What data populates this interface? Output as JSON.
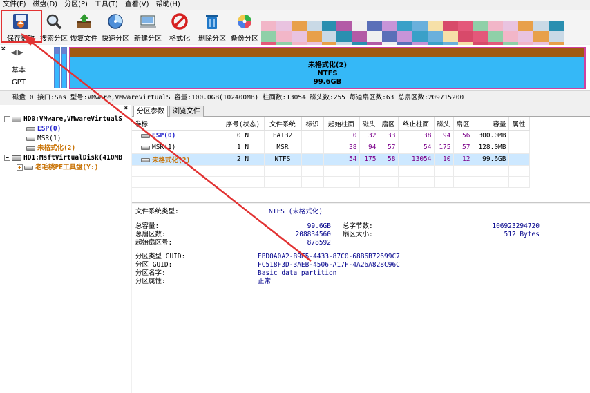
{
  "menu": [
    "文件(F)",
    "磁盘(D)",
    "分区(P)",
    "工具(T)",
    "查看(V)",
    "帮助(H)"
  ],
  "toolbar": {
    "save": "保存更改",
    "search": "搜索分区",
    "restore": "恢复文件",
    "quick": "快速分区",
    "new": "新建分区",
    "format": "格式化",
    "delete": "删除分区",
    "backup": "备份分区"
  },
  "disk_panel": {
    "kind": "基本",
    "scheme": "GPT",
    "partition_name": "未格式化(2)",
    "partition_fs": "NTFS",
    "partition_size": "99.6GB"
  },
  "disk_info": "磁盘 0 接口:Sas  型号:VMware,VMwareVirtualS  容量:100.0GB(102400MB)  柱面数:13054  磁头数:255  每道扇区数:63  总扇区数:209715200",
  "tree": {
    "disk0": "HD0:VMware,VMwareVirtualS",
    "disk0_parts": [
      "ESP(0)",
      "MSR(1)",
      "未格式化(2)"
    ],
    "disk1": "HD1:MsftVirtualDisk(410MB",
    "disk1_parts": [
      "老毛桃PE工具盘(Y:)"
    ]
  },
  "tabs": [
    "分区参数",
    "浏览文件"
  ],
  "table": {
    "headers": [
      "卷标",
      "序号(状态)",
      "文件系统",
      "标识",
      "起始柱面",
      "磁头",
      "扇区",
      "终止柱面",
      "磁头",
      "扇区",
      "容量",
      "属性"
    ],
    "rows": [
      {
        "label": "ESP(0)",
        "index": "0 N",
        "fs": "FAT32",
        "flag": "",
        "start_cyl": "0",
        "start_head": "32",
        "start_sec": "33",
        "end_cyl": "38",
        "end_head": "94",
        "end_sec": "56",
        "size": "300.0MB",
        "attr": ""
      },
      {
        "label": "MSR(1)",
        "index": "1 N",
        "fs": "MSR",
        "flag": "",
        "start_cyl": "38",
        "start_head": "94",
        "start_sec": "57",
        "end_cyl": "54",
        "end_head": "175",
        "end_sec": "57",
        "size": "128.0MB",
        "attr": ""
      },
      {
        "label": "未格式化(2)",
        "index": "2 N",
        "fs": "NTFS",
        "flag": "",
        "start_cyl": "54",
        "start_head": "175",
        "start_sec": "58",
        "end_cyl": "13054",
        "end_head": "10",
        "end_sec": "12",
        "size": "99.6GB",
        "attr": ""
      }
    ]
  },
  "details": {
    "fs_type_label": "文件系统类型:",
    "fs_type_value": "NTFS (未格式化)",
    "total_size_label": "总容量:",
    "total_size_value": "99.6GB",
    "total_bytes_label": "总字节数:",
    "total_bytes_value": "106923294720",
    "total_sectors_label": "总扇区数:",
    "total_sectors_value": "208834560",
    "sector_size_label": "扇区大小:",
    "sector_size_value": "512 Bytes",
    "start_sector_label": "起始扇区号:",
    "start_sector_value": "878592",
    "type_guid_label": "分区类型 GUID:",
    "type_guid_value": "EBD0A0A2-B9E5-4433-87C0-68B6B72699C7",
    "part_guid_label": "分区 GUID:",
    "part_guid_value": "FC518F3D-3AEB-4506-A17F-4A26A828C96C",
    "part_name_label": "分区名字:",
    "part_name_value": "Basic data partition",
    "part_attr_label": "分区属性:",
    "part_attr_value": "正常"
  },
  "colors": {
    "highlight_red": "#e23232",
    "partition_blue": "#35b8f7",
    "partition_border": "#d0419e",
    "selected_row": "#cde8ff"
  }
}
